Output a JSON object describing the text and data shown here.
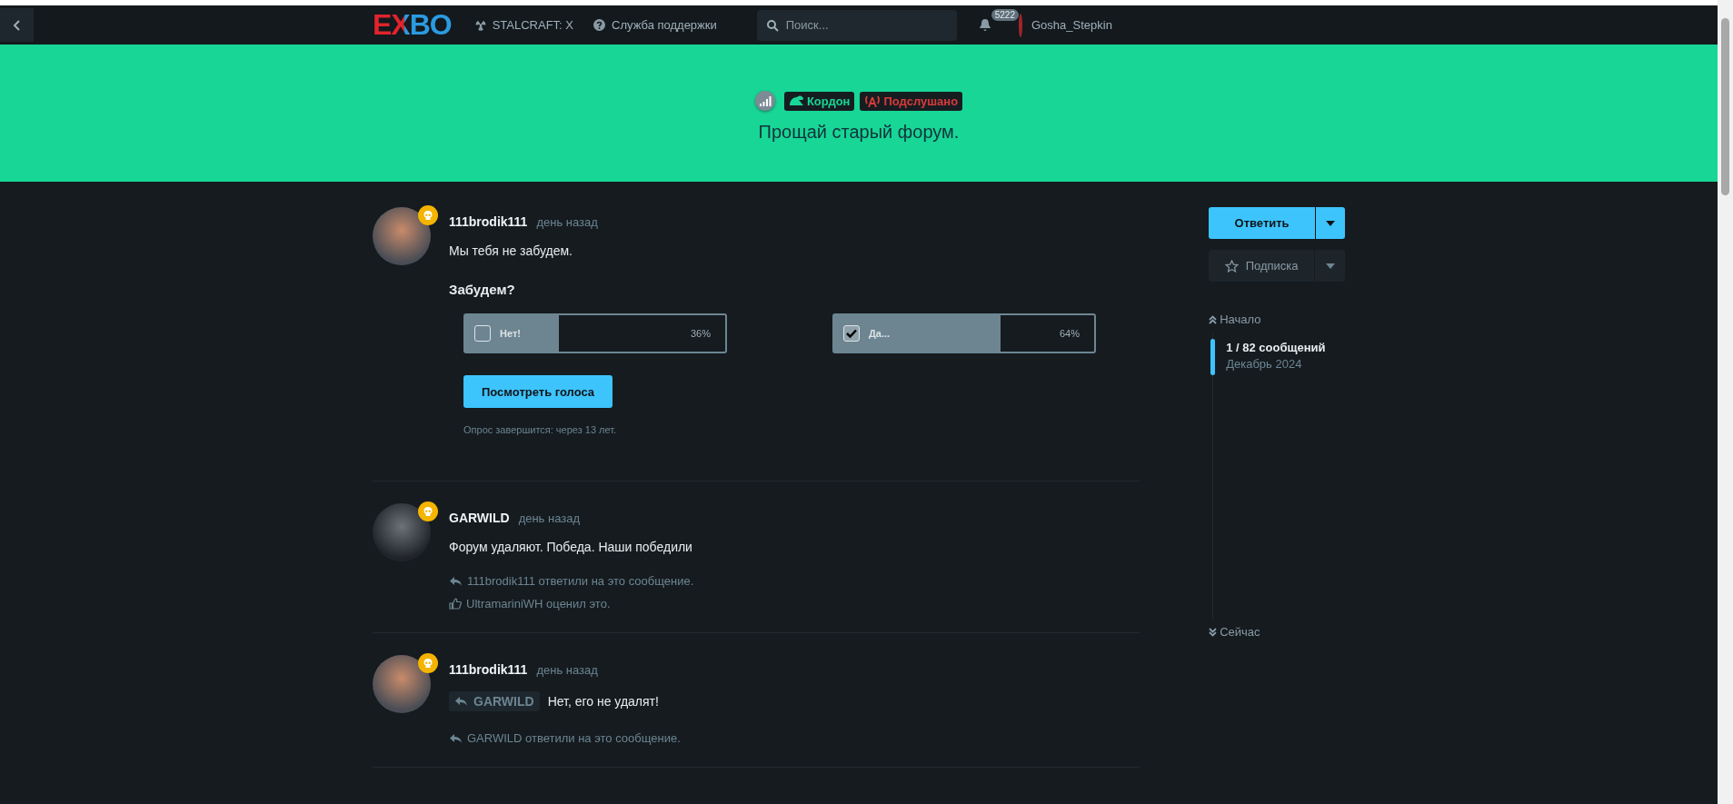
{
  "header": {
    "logo": "EXBO",
    "nav": [
      {
        "kind": "radiation",
        "label": "STALCRAFT: X"
      },
      {
        "kind": "help",
        "label": "Служба поддержки"
      }
    ],
    "search": {
      "placeholder": "Поиск..."
    },
    "notifications": "5222",
    "username": "Gosha_Stepkin"
  },
  "banner": {
    "tags": [
      {
        "kind": "frog",
        "label": "Кордон",
        "color": "#17d696"
      },
      {
        "kind": "antenna",
        "label": "Подслушано",
        "color": "#d83b3b"
      }
    ],
    "title": "Прощай старый форум."
  },
  "posts": [
    {
      "author": "111brodik111",
      "time": "день назад",
      "body": "Мы тебя не забудем.",
      "poll": {
        "question": "Забудем?",
        "options": [
          {
            "label": "Нет!",
            "checked": false,
            "level": 0.36,
            "percent": "36%"
          },
          {
            "label": "Да...",
            "checked": true,
            "level": 0.64,
            "percent": "64%"
          }
        ],
        "button": "Посмотреть голоса",
        "footer": "Опрос завершится: через 13 лет."
      }
    },
    {
      "author": "GARWILD",
      "time": "день назад",
      "body": "Форум удаляют. Победа. Наши победили",
      "activity": [
        {
          "kind": "reply",
          "text": "111brodik111 ответили на это сообщение."
        },
        {
          "kind": "like",
          "text": "UltramariniWH оценил это."
        }
      ]
    },
    {
      "author": "111brodik111",
      "time": "день назад",
      "reply_to": "GARWILD",
      "body": "Нет, его не удалят!",
      "activity": [
        {
          "kind": "reply",
          "text": "GARWILD ответили на это сообщение."
        }
      ]
    }
  ],
  "sidebar": {
    "reply_button": "Ответить",
    "subscribe_button": "Подписка",
    "start": "Начало",
    "position": "1 / 82 сообщений",
    "date": "Декабрь 2024",
    "end": "Сейчас"
  }
}
